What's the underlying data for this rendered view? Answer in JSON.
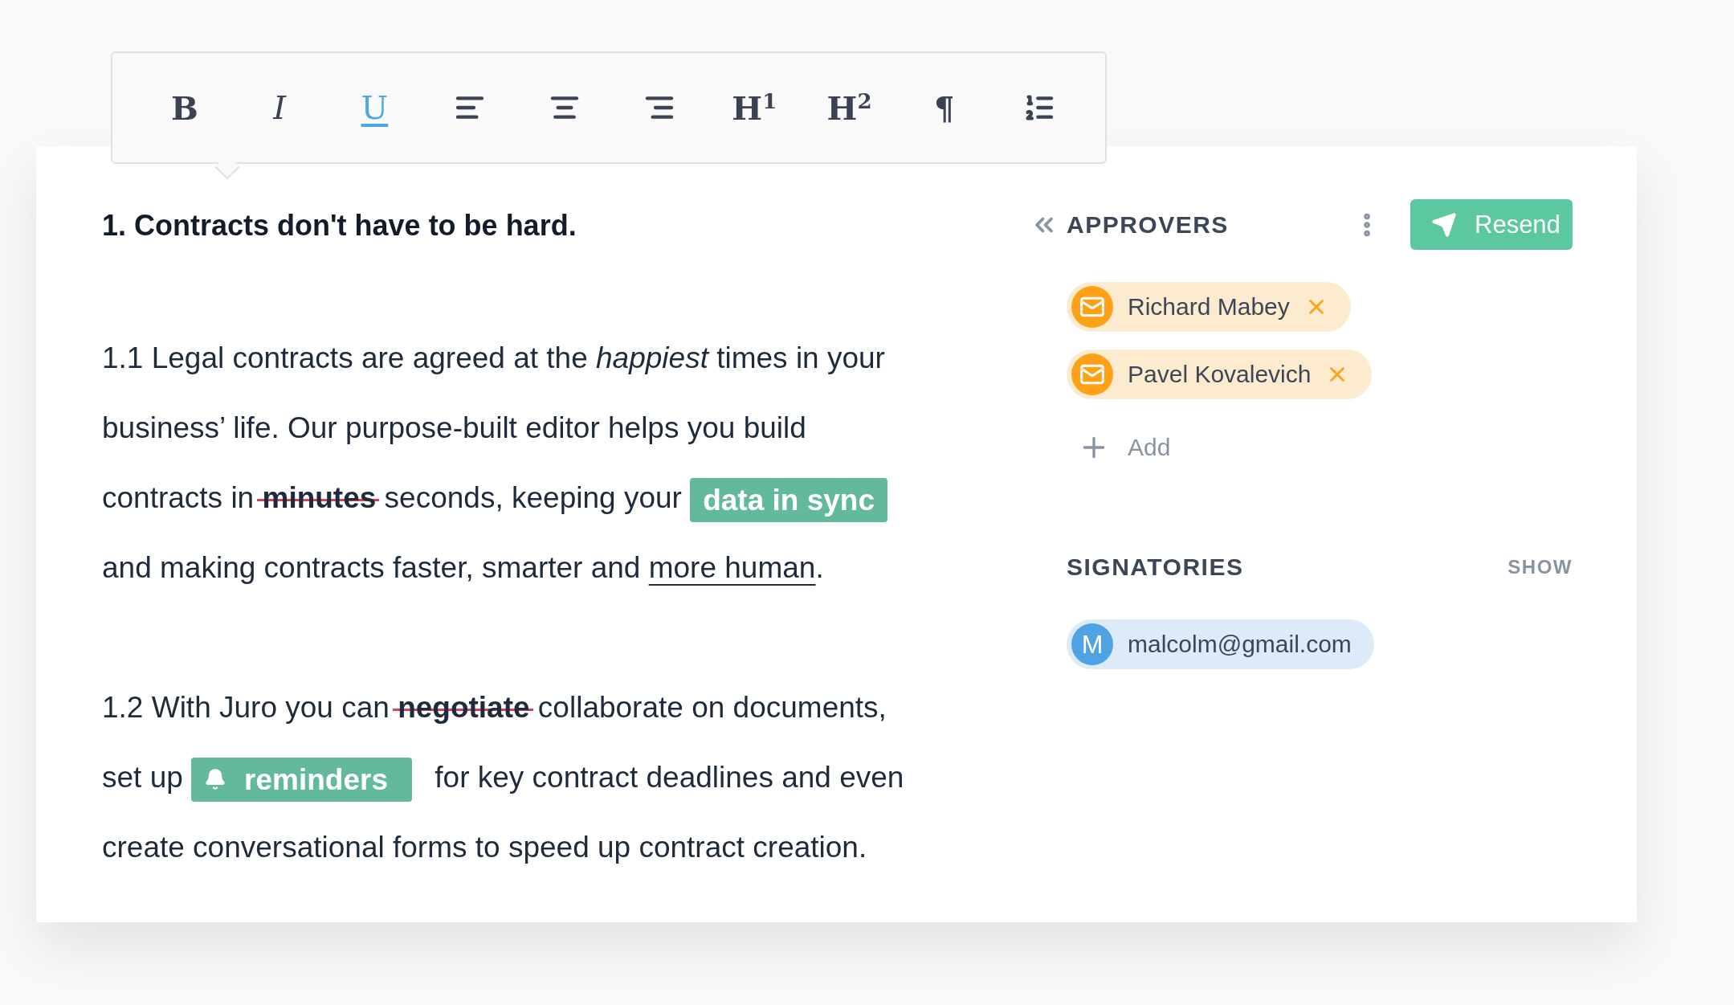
{
  "toolbar": {
    "tools": [
      {
        "kind": "bold",
        "label": "B",
        "selected": false
      },
      {
        "kind": "italic",
        "label": "I",
        "selected": false
      },
      {
        "kind": "underline",
        "label": "U",
        "selected": true
      },
      {
        "kind": "align-left",
        "selected": false
      },
      {
        "kind": "align-center",
        "selected": false
      },
      {
        "kind": "align-right",
        "selected": false
      },
      {
        "kind": "heading",
        "label": "H$^{1}$",
        "selected": false
      },
      {
        "kind": "heading",
        "label": "H$^{2}$",
        "selected": false
      },
      {
        "kind": "paragraph",
        "label": "¶",
        "selected": false
      },
      {
        "kind": "numbered-list",
        "selected": false
      }
    ]
  },
  "document": {
    "heading": "1. Contracts don't have to be hard.",
    "paragraphs": [
      {
        "lines": [
          [
            {
              "kind": "text",
              "text": "1.1 Legal contracts are agreed at the "
            },
            {
              "kind": "italic",
              "text": "happiest"
            },
            {
              "kind": "text",
              "text": " times in your"
            }
          ],
          [
            {
              "kind": "text",
              "text": "business’ life. Our purpose-built editor helps you build"
            }
          ],
          [
            {
              "kind": "text",
              "text": "contracts in "
            },
            {
              "kind": "struck",
              "text": "minutes"
            },
            {
              "kind": "text",
              "text": " seconds, keeping your "
            },
            {
              "kind": "tag",
              "text": "data in sync"
            }
          ],
          [
            {
              "kind": "text",
              "text": "and making contracts faster, smarter and "
            },
            {
              "kind": "link",
              "text": "more human"
            },
            {
              "kind": "text",
              "text": "."
            }
          ]
        ]
      },
      {
        "lines": [
          [
            {
              "kind": "text",
              "text": "1.2 With Juro you can "
            },
            {
              "kind": "struck",
              "text": "negotiate"
            },
            {
              "kind": "text",
              "text": " collaborate on documents,"
            }
          ],
          [
            {
              "kind": "text",
              "text": "set up "
            },
            {
              "kind": "reminder",
              "text": "reminders"
            },
            {
              "kind": "text",
              "text": " for key contract deadlines and even"
            }
          ],
          [
            {
              "kind": "text",
              "text": "create conversational forms to speed up contract creation."
            }
          ]
        ]
      }
    ]
  },
  "approvers": {
    "title": "APPROVERS",
    "button": "Resend",
    "people": [
      {
        "name": "Richard Mabey"
      },
      {
        "name": "Pavel Kovalevich"
      }
    ],
    "add": "Add"
  },
  "signatories": {
    "title": "SIGNATORIES",
    "toggle": "SHOW",
    "people": [
      {
        "initial": "M",
        "email": "malcolm@gmail.com"
      }
    ]
  }
}
